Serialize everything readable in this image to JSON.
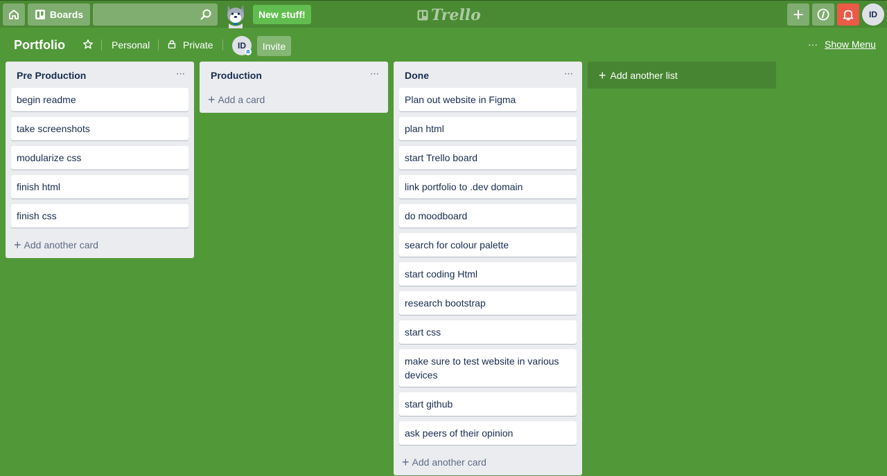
{
  "colors": {
    "board_bg": "#519839",
    "topbar_bg": "#498a33",
    "new_stuff_bg": "#61bd4f",
    "notification_bg": "#eb5a46",
    "list_bg": "#ebecf0",
    "card_bg": "#ffffff"
  },
  "topbar": {
    "home_icon": "home-icon",
    "boards_label": "Boards",
    "search": {
      "value": "",
      "placeholder": ""
    },
    "mascot": "husky-mascot",
    "new_stuff_label": "New stuff!",
    "brand_name": "Trello",
    "create_icon": "plus-icon",
    "info_icon": "info-icon",
    "notification_icon": "bell-icon",
    "avatar_initials": "ID"
  },
  "board": {
    "title": "Portfolio",
    "visibility_team": "Personal",
    "visibility_privacy": "Private",
    "member_initials": "ID",
    "invite_label": "Invite",
    "menu_dots": "···",
    "show_menu_label": "Show Menu"
  },
  "lists": [
    {
      "title": "Pre Production",
      "menu": "···",
      "cards": [
        "begin readme",
        "take screenshots",
        "modularize css",
        "finish html",
        "finish css"
      ],
      "add_label": "Add another card"
    },
    {
      "title": "Production",
      "menu": "···",
      "cards": [],
      "add_label": "Add a card"
    },
    {
      "title": "Done",
      "menu": "···",
      "cards": [
        "Plan out website in Figma",
        "plan html",
        "start Trello board",
        "link portfolio to .dev domain",
        "do moodboard",
        "search for colour palette",
        "start coding Html",
        "research bootstrap",
        "start css",
        "make sure to test website in various devices",
        "start github",
        "ask peers of their opinion"
      ],
      "add_label": "Add another card"
    }
  ],
  "add_list_label": "Add another list",
  "plus_glyph": "+"
}
